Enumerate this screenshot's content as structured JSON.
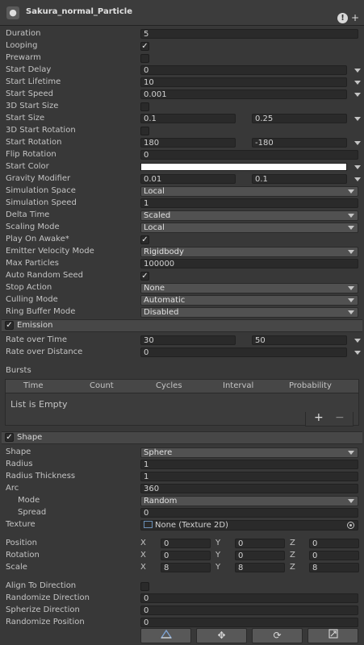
{
  "header": {
    "title": "Sakura_normal_Particle",
    "help_icon": "help-icon",
    "add_icon": "plus-icon",
    "object_icon": "particle-object-icon"
  },
  "main": {
    "duration": {
      "label": "Duration",
      "value": "5"
    },
    "looping": {
      "label": "Looping",
      "checked": true
    },
    "prewarm": {
      "label": "Prewarm",
      "checked": false
    },
    "start_delay": {
      "label": "Start Delay",
      "value": "0"
    },
    "start_lifetime": {
      "label": "Start Lifetime",
      "value": "10"
    },
    "start_speed": {
      "label": "Start Speed",
      "value": "0.001"
    },
    "start_size_3d": {
      "label": "3D Start Size",
      "checked": false
    },
    "start_size": {
      "label": "Start Size",
      "min": "0.1",
      "max": "0.25"
    },
    "start_rotation_3d": {
      "label": "3D Start Rotation",
      "checked": false
    },
    "start_rotation": {
      "label": "Start Rotation",
      "min": "180",
      "max": "-180"
    },
    "flip_rotation": {
      "label": "Flip Rotation",
      "value": "0"
    },
    "start_color": {
      "label": "Start Color",
      "color": "#ffffff"
    },
    "gravity_modifier": {
      "label": "Gravity Modifier",
      "min": "0.01",
      "max": "0.1"
    },
    "simulation_space": {
      "label": "Simulation Space",
      "value": "Local"
    },
    "simulation_speed": {
      "label": "Simulation Speed",
      "value": "1"
    },
    "delta_time": {
      "label": "Delta Time",
      "value": "Scaled"
    },
    "scaling_mode": {
      "label": "Scaling Mode",
      "value": "Local"
    },
    "play_on_awake": {
      "label": "Play On Awake*",
      "checked": true
    },
    "emitter_velocity_mode": {
      "label": "Emitter Velocity Mode",
      "value": "Rigidbody"
    },
    "max_particles": {
      "label": "Max Particles",
      "value": "100000"
    },
    "auto_random_seed": {
      "label": "Auto Random Seed",
      "checked": true
    },
    "stop_action": {
      "label": "Stop Action",
      "value": "None"
    },
    "culling_mode": {
      "label": "Culling Mode",
      "value": "Automatic"
    },
    "ring_buffer_mode": {
      "label": "Ring Buffer Mode",
      "value": "Disabled"
    }
  },
  "emission": {
    "title": "Emission",
    "enabled": true,
    "rate_over_time": {
      "label": "Rate over Time",
      "min": "30",
      "max": "50"
    },
    "rate_over_distance": {
      "label": "Rate over Distance",
      "value": "0"
    },
    "bursts": {
      "label": "Bursts",
      "columns": [
        "Time",
        "Count",
        "Cycles",
        "Interval",
        "Probability"
      ],
      "empty_text": "List is Empty",
      "add": "+",
      "remove": "−"
    }
  },
  "shape": {
    "title": "Shape",
    "enabled": true,
    "shape": {
      "label": "Shape",
      "value": "Sphere"
    },
    "radius": {
      "label": "Radius",
      "value": "1"
    },
    "radius_thickness": {
      "label": "Radius Thickness",
      "value": "1"
    },
    "arc": {
      "label": "Arc",
      "value": "360"
    },
    "mode": {
      "label": "Mode",
      "value": "Random"
    },
    "spread": {
      "label": "Spread",
      "value": "0"
    },
    "texture": {
      "label": "Texture",
      "value": "None (Texture 2D)"
    },
    "position": {
      "label": "Position",
      "x": "0",
      "y": "0",
      "z": "0"
    },
    "rotation": {
      "label": "Rotation",
      "x": "0",
      "y": "0",
      "z": "0"
    },
    "scale": {
      "label": "Scale",
      "x": "8",
      "y": "8",
      "z": "8"
    },
    "axis_labels": {
      "x": "X",
      "y": "Y",
      "z": "Z"
    },
    "align_to_direction": {
      "label": "Align To Direction",
      "checked": false
    },
    "randomize_direction": {
      "label": "Randomize Direction",
      "value": "0"
    },
    "spherize_direction": {
      "label": "Spherize Direction",
      "value": "0"
    },
    "randomize_position": {
      "label": "Randomize Position",
      "value": "0"
    }
  },
  "toolbar": {
    "icons": [
      "edit-shape-icon",
      "move-icon",
      "rotate-icon",
      "scale-icon"
    ]
  }
}
